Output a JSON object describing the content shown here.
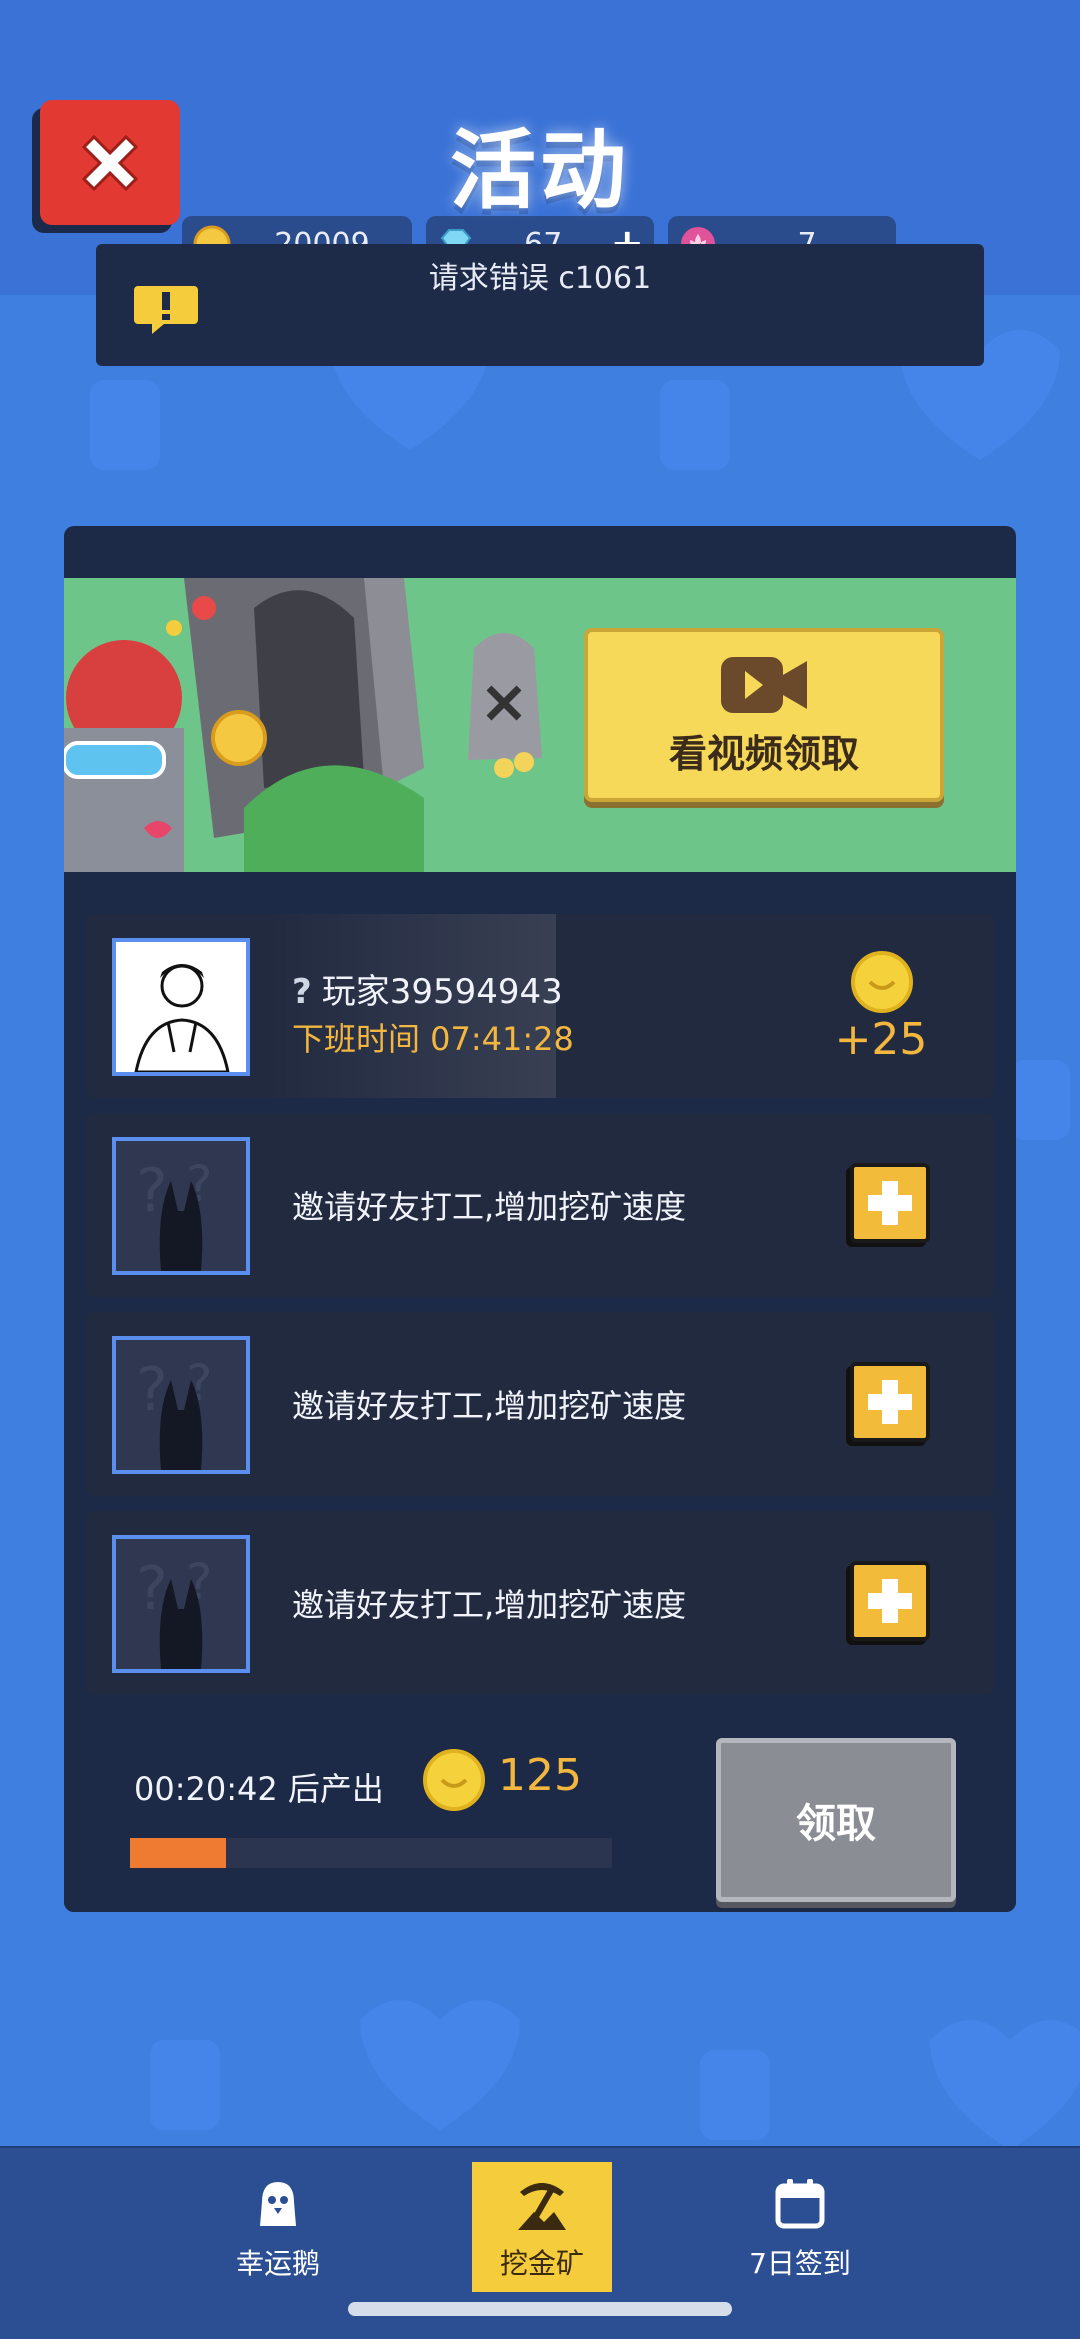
{
  "header": {
    "title": "活动",
    "close_label": "关闭"
  },
  "currencies": {
    "coins": "20009",
    "gems": "67",
    "gems_add": "+",
    "lotus": "7"
  },
  "error": {
    "message": "请求错误 c1061"
  },
  "banner": {
    "video_button_label": "看视频领取"
  },
  "slots": [
    {
      "type": "player",
      "name_prefix": "?",
      "player_name": "玩家39594943",
      "shift_time": "下班时间 07:41:28",
      "reward": "+25"
    },
    {
      "type": "invite",
      "text": "邀请好友打工,增加挖矿速度"
    },
    {
      "type": "invite",
      "text": "邀请好友打工,增加挖矿速度"
    },
    {
      "type": "invite",
      "text": "邀请好友打工,增加挖矿速度"
    }
  ],
  "production": {
    "timer_text": "00:20:42 后产出",
    "amount": "125",
    "progress_fraction": 0.2,
    "claim_label": "领取"
  },
  "bottom_nav": [
    {
      "label": "幸运鹅",
      "icon": "goose-icon",
      "active": false
    },
    {
      "label": "挖金矿",
      "icon": "pickaxe-icon",
      "active": true
    },
    {
      "label": "7日签到",
      "icon": "calendar-icon",
      "active": false
    }
  ],
  "colors": {
    "background": "#3f7fe0",
    "panel": "#1c2a47",
    "accent_gold": "#f3b63f",
    "progress": "#ef7a32",
    "close_red": "#e23a33"
  }
}
